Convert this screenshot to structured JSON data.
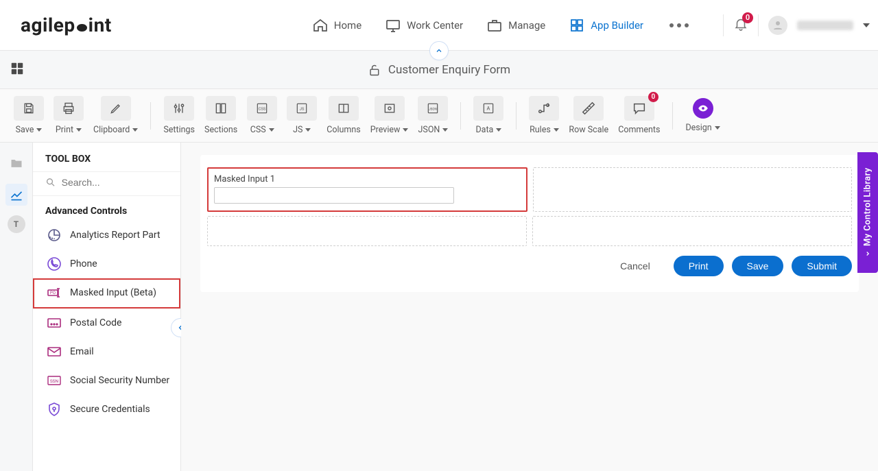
{
  "brand": "agilepoint",
  "nav": {
    "home": "Home",
    "work_center": "Work Center",
    "manage": "Manage",
    "app_builder": "App Builder"
  },
  "notifications": {
    "count": "0"
  },
  "subheader": {
    "title": "Customer Enquiry Form"
  },
  "toolbar": {
    "save": "Save",
    "print": "Print",
    "clipboard": "Clipboard",
    "settings": "Settings",
    "sections": "Sections",
    "css": "CSS",
    "js": "JS",
    "columns": "Columns",
    "preview": "Preview",
    "json": "JSON",
    "data": "Data",
    "rules": "Rules",
    "row_scale": "Row Scale",
    "comments": "Comments",
    "comments_count": "0",
    "design": "Design"
  },
  "toolbox": {
    "title": "TOOL BOX",
    "search_placeholder": "Search...",
    "section_heading": "Advanced Controls",
    "items": [
      {
        "label": "Analytics Report Part"
      },
      {
        "label": "Phone"
      },
      {
        "label": "Masked Input (Beta)"
      },
      {
        "label": "Postal Code"
      },
      {
        "label": "Email"
      },
      {
        "label": "Social Security Number"
      },
      {
        "label": "Secure Credentials"
      }
    ]
  },
  "leftrail_letter": "T",
  "canvas": {
    "selected_control_label": "Masked Input 1",
    "buttons": {
      "cancel": "Cancel",
      "print": "Print",
      "save": "Save",
      "submit": "Submit"
    }
  },
  "side_tab": "My Control Library"
}
